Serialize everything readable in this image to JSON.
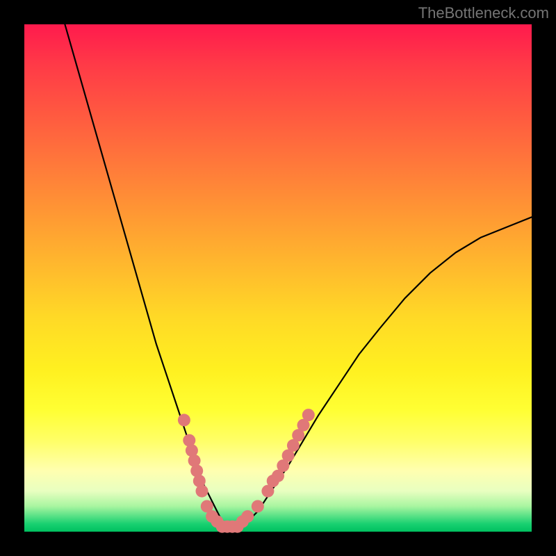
{
  "watermark": "TheBottleneck.com",
  "chart_data": {
    "type": "line",
    "title": "",
    "xlabel": "",
    "ylabel": "",
    "xlim": [
      0,
      100
    ],
    "ylim": [
      0,
      100
    ],
    "series": [
      {
        "name": "bottleneck-curve",
        "x": [
          8,
          10,
          12,
          14,
          16,
          18,
          20,
          22,
          24,
          26,
          28,
          30,
          32,
          34,
          35,
          36,
          37,
          38,
          39,
          40,
          41,
          42,
          44,
          46,
          48,
          50,
          52,
          55,
          58,
          62,
          66,
          70,
          75,
          80,
          85,
          90,
          95,
          100
        ],
        "y": [
          100,
          93,
          86,
          79,
          72,
          65,
          58,
          51,
          44,
          37,
          31,
          25,
          19,
          13,
          10,
          8,
          6,
          4,
          2,
          1,
          1,
          1,
          2,
          4,
          7,
          10,
          13,
          18,
          23,
          29,
          35,
          40,
          46,
          51,
          55,
          58,
          60,
          62
        ]
      }
    ],
    "markers": {
      "name": "highlight-points",
      "color": "#e07878",
      "points": [
        {
          "x": 31.5,
          "y": 22
        },
        {
          "x": 32.5,
          "y": 18
        },
        {
          "x": 33.0,
          "y": 16
        },
        {
          "x": 33.5,
          "y": 14
        },
        {
          "x": 34.0,
          "y": 12
        },
        {
          "x": 34.5,
          "y": 10
        },
        {
          "x": 35.0,
          "y": 8
        },
        {
          "x": 36.0,
          "y": 5
        },
        {
          "x": 37.0,
          "y": 3
        },
        {
          "x": 38.0,
          "y": 2
        },
        {
          "x": 39.0,
          "y": 1
        },
        {
          "x": 40.0,
          "y": 1
        },
        {
          "x": 41.0,
          "y": 1
        },
        {
          "x": 42.0,
          "y": 1
        },
        {
          "x": 43.0,
          "y": 2
        },
        {
          "x": 44.0,
          "y": 3
        },
        {
          "x": 46.0,
          "y": 5
        },
        {
          "x": 48.0,
          "y": 8
        },
        {
          "x": 49.0,
          "y": 10
        },
        {
          "x": 50.0,
          "y": 11
        },
        {
          "x": 51.0,
          "y": 13
        },
        {
          "x": 52.0,
          "y": 15
        },
        {
          "x": 53.0,
          "y": 17
        },
        {
          "x": 54.0,
          "y": 19
        },
        {
          "x": 55.0,
          "y": 21
        },
        {
          "x": 56.0,
          "y": 23
        }
      ]
    }
  }
}
